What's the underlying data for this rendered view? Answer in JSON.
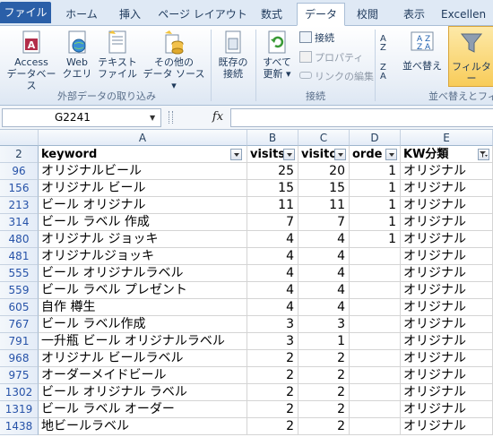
{
  "tabs": [
    "ファイル",
    "ホーム",
    "挿入",
    "ページ レイアウト",
    "数式",
    "データ",
    "校閲",
    "表示",
    "Excellen"
  ],
  "ribbon": {
    "access": [
      "Access",
      "データベース"
    ],
    "web": [
      "Web",
      "クエリ"
    ],
    "text": [
      "テキスト",
      "ファイル"
    ],
    "other": [
      "その他の",
      "データ ソース ▾"
    ],
    "existing": [
      "既存の",
      "接続"
    ],
    "refresh": [
      "すべて",
      "更新 ▾"
    ],
    "connections": "接続",
    "properties": "プロパティ",
    "edit_links": "リンクの編集",
    "sort": "並べ替え",
    "filter": "フィルター",
    "group_external": "外部データの取り込み",
    "group_connections": "接続",
    "group_sort": "並べ替えとフィル"
  },
  "formula_bar": {
    "name_box": "G2241",
    "fx": "fx"
  },
  "columns": [
    "A",
    "B",
    "C",
    "D",
    "E"
  ],
  "header_row": {
    "row": "2",
    "keyword": "keyword",
    "visits": "visits",
    "visitors": "visito",
    "orders": "orde",
    "kw": "KW分類"
  },
  "rows": [
    {
      "row": "96",
      "keyword": "オリジナルビール",
      "b": "25",
      "c": "20",
      "d": "1",
      "e": "オリジナル"
    },
    {
      "row": "156",
      "keyword": "オリジナル ビール",
      "b": "15",
      "c": "15",
      "d": "1",
      "e": "オリジナル"
    },
    {
      "row": "213",
      "keyword": "ビール オリジナル",
      "b": "11",
      "c": "11",
      "d": "1",
      "e": "オリジナル"
    },
    {
      "row": "314",
      "keyword": "ビール ラベル 作成",
      "b": "7",
      "c": "7",
      "d": "1",
      "e": "オリジナル"
    },
    {
      "row": "480",
      "keyword": "オリジナル ジョッキ",
      "b": "4",
      "c": "4",
      "d": "1",
      "e": "オリジナル"
    },
    {
      "row": "481",
      "keyword": "オリジナルジョッキ",
      "b": "4",
      "c": "4",
      "d": "",
      "e": "オリジナル"
    },
    {
      "row": "555",
      "keyword": "ビール オリジナルラベル",
      "b": "4",
      "c": "4",
      "d": "",
      "e": "オリジナル"
    },
    {
      "row": "559",
      "keyword": "ビール ラベル プレゼント",
      "b": "4",
      "c": "4",
      "d": "",
      "e": "オリジナル"
    },
    {
      "row": "605",
      "keyword": "自作 樽生",
      "b": "4",
      "c": "4",
      "d": "",
      "e": "オリジナル"
    },
    {
      "row": "767",
      "keyword": "ビール ラベル作成",
      "b": "3",
      "c": "3",
      "d": "",
      "e": "オリジナル"
    },
    {
      "row": "791",
      "keyword": "一升瓶 ビール オリジナルラベル",
      "b": "3",
      "c": "1",
      "d": "",
      "e": "オリジナル"
    },
    {
      "row": "968",
      "keyword": "オリジナル ビールラベル",
      "b": "2",
      "c": "2",
      "d": "",
      "e": "オリジナル"
    },
    {
      "row": "975",
      "keyword": "オーダーメイドビール",
      "b": "2",
      "c": "2",
      "d": "",
      "e": "オリジナル"
    },
    {
      "row": "1302",
      "keyword": "ビール オリジナル ラベル",
      "b": "2",
      "c": "2",
      "d": "",
      "e": "オリジナル"
    },
    {
      "row": "1319",
      "keyword": "ビール ラベル オーダー",
      "b": "2",
      "c": "2",
      "d": "",
      "e": "オリジナル"
    },
    {
      "row": "1438",
      "keyword": "地ビールラベル",
      "b": "2",
      "c": "2",
      "d": "",
      "e": "オリジナル"
    }
  ]
}
